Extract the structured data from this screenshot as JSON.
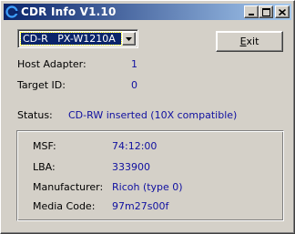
{
  "window": {
    "title": "CDR Info V1.10",
    "titlebar_start_color": "#0a246a",
    "titlebar_end_color": "#a6caf0",
    "icons": {
      "app": "cdr-app-icon",
      "minimize": "minimize-icon",
      "maximize": "maximize-icon",
      "close": "close-icon"
    }
  },
  "drive_select": {
    "selected": "CD-R   PX-W1210A",
    "arrow_icon": "chevron-down-icon"
  },
  "exit_button": {
    "label_underlined": "E",
    "label_rest": "xit"
  },
  "info": {
    "host_adapter": {
      "label": "Host Adapter:",
      "value": "1"
    },
    "target_id": {
      "label": "Target ID:",
      "value": "0"
    },
    "status": {
      "label": "Status:",
      "value": "CD-RW inserted (10X compatible)"
    }
  },
  "media": {
    "msf": {
      "label": "MSF:",
      "value": "74:12:00"
    },
    "lba": {
      "label": "LBA:",
      "value": "333900"
    },
    "manufacturer": {
      "label": "Manufacturer:",
      "value": "Ricoh (type 0)"
    },
    "media_code": {
      "label": "Media Code:",
      "value": "97m27s00f"
    }
  },
  "colors": {
    "value_text": "#1010a0",
    "face": "#d4d0c8",
    "selection": "#0a246a"
  }
}
